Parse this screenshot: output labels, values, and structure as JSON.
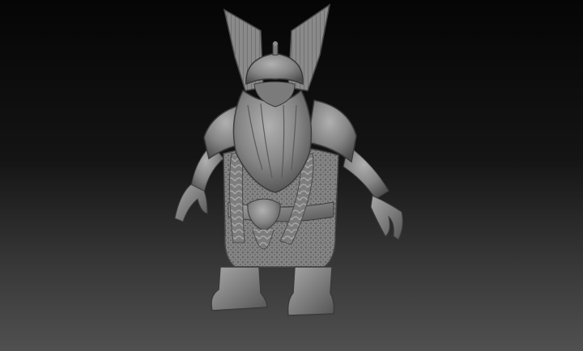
{
  "scene": {
    "subject": "dwarf-warrior-sculpt",
    "colors": {
      "background_top": "#050505",
      "background_bottom": "#505050",
      "clay": "#8c8c8c",
      "clay_shadow": "#4a4a4a",
      "clay_highlight": "#b4b4b4"
    }
  }
}
